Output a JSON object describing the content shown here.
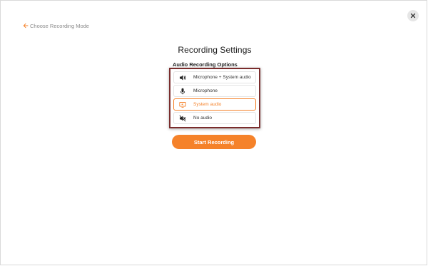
{
  "header": {
    "back_label": "Choose Recording Mode"
  },
  "main": {
    "title": "Recording Settings",
    "subtitle": "Audio Recording Options",
    "options": [
      {
        "label": "Microphone + System audio",
        "icon": "speaker-icon"
      },
      {
        "label": "Microphone",
        "icon": "microphone-icon"
      },
      {
        "label": "System audio",
        "icon": "monitor-audio-icon",
        "selected": true
      },
      {
        "label": "No audio",
        "icon": "speaker-muted-icon"
      }
    ],
    "start_label": "Start Recording"
  },
  "colors": {
    "accent": "#f5822a",
    "highlight_border": "#7a2c2c",
    "text": "#333333",
    "muted": "#8a8a8a"
  }
}
